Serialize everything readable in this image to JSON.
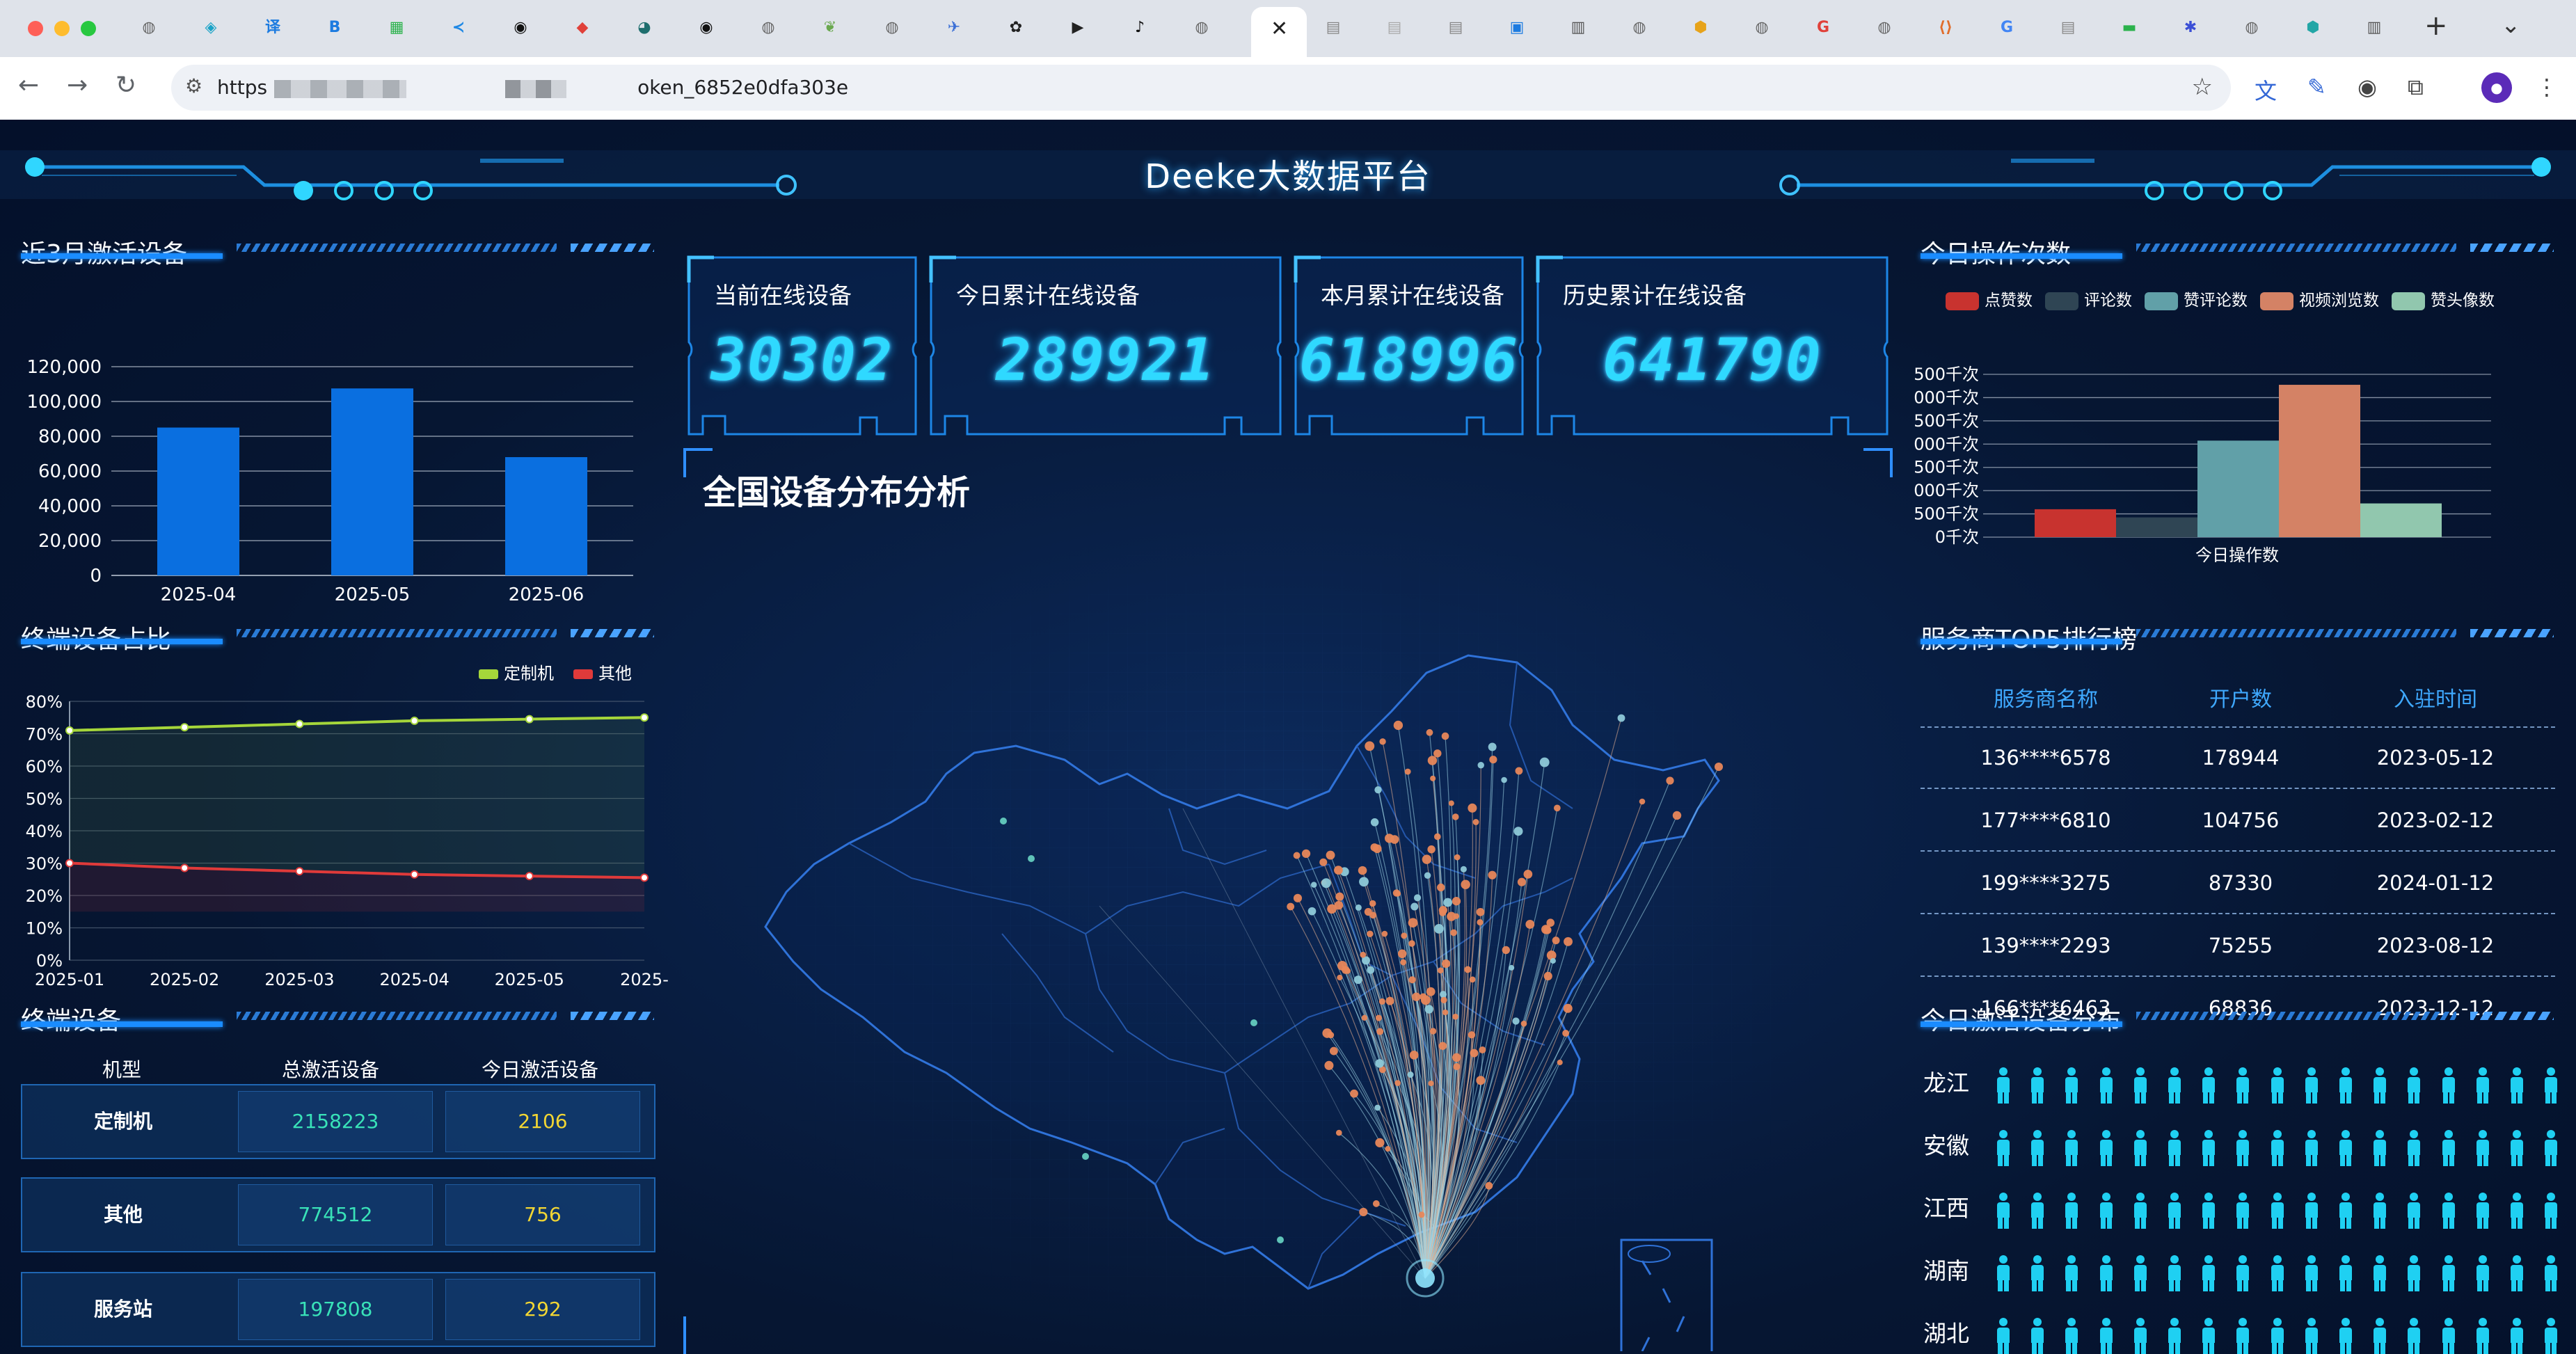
{
  "browser": {
    "url_prefix": "https",
    "url_suffix": "oken_6852e0dfa303e",
    "tabs": [
      {
        "icon": "globe-icon",
        "color": "#666"
      },
      {
        "icon": "bot-icon",
        "color": "#1aa3c7"
      },
      {
        "icon": "translate-icon",
        "color": "#1c7be0"
      },
      {
        "icon": "bracket-icon",
        "color": "#1c7be0"
      },
      {
        "icon": "grid-icon",
        "color": "#2bb24c"
      },
      {
        "icon": "vscode-icon",
        "color": "#1e88e5"
      },
      {
        "icon": "github-icon",
        "color": "#111"
      },
      {
        "icon": "diamond-icon",
        "color": "#e0413a"
      },
      {
        "icon": "octopus-icon",
        "color": "#1e6e6e"
      },
      {
        "icon": "github-icon",
        "color": "#111"
      },
      {
        "icon": "globe-icon",
        "color": "#666"
      },
      {
        "icon": "leaf-icon",
        "color": "#6aa84f"
      },
      {
        "icon": "globe-icon",
        "color": "#666"
      },
      {
        "icon": "bird-icon",
        "color": "#3b6fd6"
      },
      {
        "icon": "openai-icon",
        "color": "#222"
      },
      {
        "icon": "cursor-icon",
        "color": "#222"
      },
      {
        "icon": "tiktok-icon",
        "color": "#111"
      },
      {
        "icon": "globe-icon",
        "color": "#666"
      },
      {
        "icon": "doc-icon",
        "color": "#888"
      },
      {
        "icon": "doc-icon",
        "color": "#aaa"
      },
      {
        "icon": "doc-icon",
        "color": "#888"
      },
      {
        "icon": "app-icon",
        "color": "#1c7be0"
      },
      {
        "icon": "book-icon",
        "color": "#555"
      },
      {
        "icon": "globe-icon",
        "color": "#666"
      },
      {
        "icon": "cube-icon",
        "color": "#e7a31a"
      },
      {
        "icon": "globe-icon",
        "color": "#666"
      },
      {
        "icon": "g-icon",
        "color": "#e0413a"
      },
      {
        "icon": "globe-icon",
        "color": "#666"
      },
      {
        "icon": "code-icon",
        "color": "#e06c2a"
      },
      {
        "icon": "google-icon",
        "color": "#4285f4"
      },
      {
        "icon": "doc-icon",
        "color": "#888"
      },
      {
        "icon": "chat-icon",
        "color": "#2bb24c"
      },
      {
        "icon": "paw-icon",
        "color": "#3b4fd6"
      },
      {
        "icon": "globe-icon",
        "color": "#666"
      },
      {
        "icon": "cube-icon",
        "color": "#22a6a6"
      },
      {
        "icon": "book-icon",
        "color": "#555"
      }
    ]
  },
  "header": {
    "title": "Deeke大数据平台"
  },
  "activation": {
    "title": "近3月激活设备",
    "chart_data": {
      "type": "bar",
      "categories": [
        "2025-04",
        "2025-05",
        "2025-06"
      ],
      "values": [
        85000,
        107500,
        68000
      ],
      "ylim": [
        0,
        120000
      ],
      "yticks": [
        "0",
        "20,000",
        "40,000",
        "60,000",
        "80,000",
        "100,000",
        "120,000"
      ],
      "color": "#0a6fe0"
    }
  },
  "ratio": {
    "title": "终端设备占比",
    "chart_data": {
      "type": "line",
      "x": [
        "2025-01",
        "2025-02",
        "2025-03",
        "2025-04",
        "2025-05",
        "2025-06"
      ],
      "xticks": [
        "2025-01",
        "2025-02",
        "2025-03",
        "2025-04",
        "2025-05",
        "2025-"
      ],
      "series": [
        {
          "name": "定制机",
          "values": [
            71,
            72,
            73,
            74,
            74.5,
            75
          ],
          "color": "#a5d63a"
        },
        {
          "name": "其他",
          "values": [
            30,
            28.5,
            27.5,
            26.5,
            26,
            25.5
          ],
          "color": "#e03a3a"
        }
      ],
      "ylim": [
        0,
        80
      ],
      "yticks": [
        "0%",
        "10%",
        "20%",
        "30%",
        "40%",
        "50%",
        "60%",
        "70%",
        "80%"
      ],
      "legend": "top-right"
    }
  },
  "terminal": {
    "title": "终端设备",
    "headers": [
      "机型",
      "总激活设备",
      "今日激活设备"
    ],
    "rows": [
      {
        "name": "定制机",
        "total": "2158223",
        "today": "2106"
      },
      {
        "name": "其他",
        "total": "774512",
        "today": "756"
      },
      {
        "name": "服务站",
        "total": "197808",
        "today": "292"
      }
    ]
  },
  "stats": [
    {
      "label": "当前在线设备",
      "value": "30302"
    },
    {
      "label": "今日累计在线设备",
      "value": "289921"
    },
    {
      "label": "本月累计在线设备",
      "value": "618996"
    },
    {
      "label": "历史累计在线设备",
      "value": "641790"
    }
  ],
  "map": {
    "title": "全国设备分布分析"
  },
  "operations": {
    "title": "今日操作次数",
    "chart_data": {
      "type": "bar",
      "categories": [
        "今日操作数"
      ],
      "series": [
        {
          "name": "点赞数",
          "values": [
            1200
          ],
          "color": "#c8332f"
        },
        {
          "name": "评论数",
          "values": [
            850
          ],
          "color": "#2f4554"
        },
        {
          "name": "赞评论数",
          "values": [
            4150
          ],
          "color": "#61a0a8"
        },
        {
          "name": "视频浏览数",
          "values": [
            6550
          ],
          "color": "#d48265"
        },
        {
          "name": "赞头像数",
          "values": [
            1450
          ],
          "color": "#91c7ae"
        }
      ],
      "ylim": [
        0,
        7000
      ],
      "yticks": [
        "0千次",
        "500千次",
        "000千次",
        "500千次",
        "000千次",
        "500千次",
        "000千次",
        "500千次"
      ],
      "legend": "top"
    }
  },
  "ranking": {
    "title": "服务商TOP5排行榜",
    "headers": [
      "服务商名称",
      "开户数",
      "入驻时间"
    ],
    "rows": [
      {
        "name": "136****6578",
        "accounts": "178944",
        "date": "2023-05-12"
      },
      {
        "name": "177****6810",
        "accounts": "104756",
        "date": "2023-02-12"
      },
      {
        "name": "199****3275",
        "accounts": "87330",
        "date": "2024-01-12"
      },
      {
        "name": "139****2293",
        "accounts": "75255",
        "date": "2023-08-12"
      },
      {
        "name": "166****6463",
        "accounts": "68836",
        "date": "2023-12-12"
      }
    ]
  },
  "province": {
    "title": "今日激活设备分布",
    "rows": [
      {
        "name": "龙江"
      },
      {
        "name": "安徽"
      },
      {
        "name": "江西"
      },
      {
        "name": "湖南"
      },
      {
        "name": "湖北"
      }
    ]
  }
}
